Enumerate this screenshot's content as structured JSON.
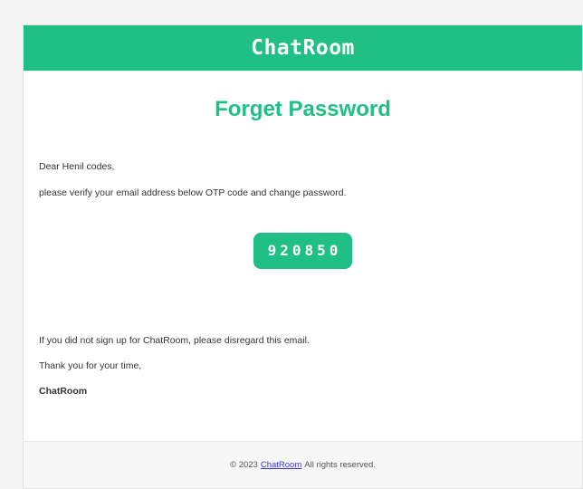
{
  "header": {
    "brand": "ChatRoom"
  },
  "main": {
    "heading": "Forget Password",
    "greeting": "Dear Henil codes,",
    "instruction": "please verify your email address below OTP code and change password.",
    "otp_code": "920850",
    "disclaimer": "If you did not sign up for ChatRoom, please disregard this email.",
    "thanks": "Thank you for your time,",
    "signature": "ChatRoom"
  },
  "footer": {
    "copyright_prefix": "© 2023",
    "link_text": "ChatRoom",
    "suffix": "All rights reserved."
  },
  "colors": {
    "accent": "#1fbf85",
    "link": "#3a34d6",
    "background": "#f4f4f4"
  }
}
